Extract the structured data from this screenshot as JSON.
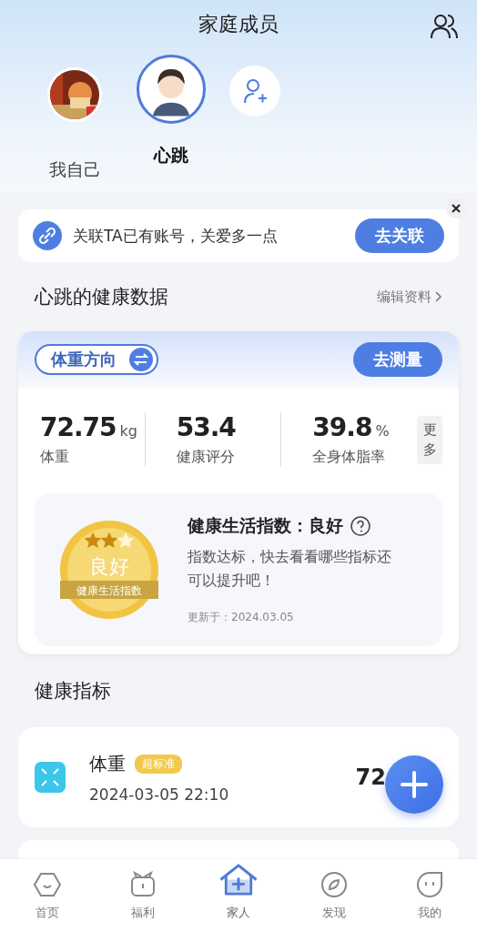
{
  "header": {
    "title": "家庭成员"
  },
  "members": [
    {
      "name": "我自己",
      "kind": "picture",
      "selected": false
    },
    {
      "name": "心跳",
      "kind": "figure",
      "selected": true
    }
  ],
  "link_banner": {
    "text": "关联TA已有账号，关爱多一点",
    "button": "去关联"
  },
  "section_title": "心跳的健康数据",
  "edit_link": "编辑资料",
  "card": {
    "mode_button": "体重方向",
    "measure_button": "去测量",
    "metrics": [
      {
        "value": "72.75",
        "unit": "kg",
        "label": "体重"
      },
      {
        "value": "53.4",
        "label": "健康评分"
      },
      {
        "value": "39.8",
        "unit": "%",
        "label": "全身体脂率"
      }
    ],
    "more": "更多",
    "medal": {
      "stars": 2,
      "grade": "良好",
      "caption": "健康生活指数"
    },
    "index_title": "健康生活指数：良好",
    "index_text": "指数达标，快去看看哪些指标还可以提升吧！",
    "updated": "更新于：2024.03.05"
  },
  "indicators_title": "健康指标",
  "indicators": [
    {
      "name": "体重",
      "tag": "超标准",
      "time": "2024-03-05 22:10",
      "value": "72"
    }
  ],
  "nav": [
    {
      "label": "首页",
      "selected": false
    },
    {
      "label": "福利",
      "selected": false
    },
    {
      "label": "家人",
      "selected": true
    },
    {
      "label": "发现",
      "selected": false
    },
    {
      "label": "我的",
      "selected": false
    }
  ]
}
